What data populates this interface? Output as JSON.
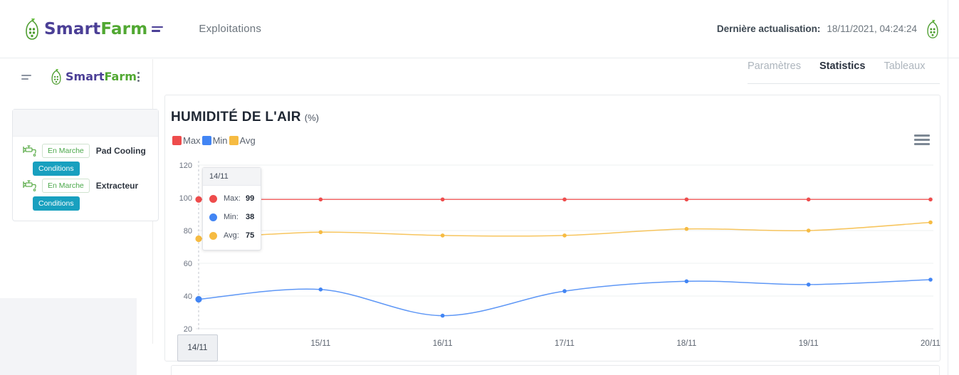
{
  "header": {
    "logo_text_part1": "Smart",
    "logo_text_part2": "Farm",
    "logo_icon": "plant-flask-icon",
    "menu_icon": "hamburger-lines-icon",
    "nav_link": "Exploitations",
    "refresh_label": "Dernière actualisation:",
    "refresh_value": "18/11/2021, 04:24:24",
    "refresh_icon": "plant-flask-icon"
  },
  "tabs": [
    {
      "label": "Paramètres",
      "active": false
    },
    {
      "label": "Statistics",
      "active": true
    },
    {
      "label": "Tableaux",
      "active": false
    }
  ],
  "left_panel": {
    "toggle_icon": "collapse-menu-icon",
    "logo_text_part1": "Smart",
    "logo_text_part2": "Farm",
    "more_icon": "vertical-dots-icon",
    "devices": [
      {
        "icon": "valve-faucet-icon",
        "status": "En Marche",
        "name": "Pad Cooling",
        "action": "Conditions"
      },
      {
        "icon": "valve-faucet-icon",
        "status": "En Marche",
        "name": "Extracteur",
        "action": "Conditions"
      }
    ]
  },
  "chart_card": {
    "title": "HUMIDITÉ DE L'AIR",
    "unit": "(%)",
    "export_menu_icon": "hamburger-menu-icon"
  },
  "tooltip": {
    "date": "14/11",
    "rows": [
      {
        "key": "Max:",
        "value": "99",
        "color": "#ee4c4c"
      },
      {
        "key": "Min:",
        "value": "38",
        "color": "#4285f4"
      },
      {
        "key": "Avg:",
        "value": "75",
        "color": "#f6bb42"
      }
    ]
  },
  "crosshair_label": "14/11",
  "colors": {
    "max": "#ee4c4c",
    "min": "#4285f4",
    "avg": "#f6bb42",
    "brand_purple": "#4b3f96",
    "brand_green": "#51a832",
    "teal_button": "#18a0bf",
    "status_green": "#4aa84a"
  },
  "chart_data": {
    "type": "line",
    "title": "HUMIDITÉ DE L'AIR (%)",
    "xlabel": "",
    "ylabel": "",
    "unit": "%",
    "categories": [
      "14/11",
      "15/11",
      "16/11",
      "17/11",
      "18/11",
      "19/11",
      "20/11"
    ],
    "ylim": [
      20,
      120
    ],
    "yticks": [
      120,
      100,
      80,
      60,
      40,
      20
    ],
    "grid": true,
    "legend_position": "top-left",
    "smooth": true,
    "series": [
      {
        "name": "Max",
        "color": "#ee4c4c",
        "values": [
          99,
          99,
          99,
          99,
          99,
          99,
          99
        ]
      },
      {
        "name": "Min",
        "color": "#4285f4",
        "values": [
          38,
          44,
          28,
          43,
          49,
          47,
          50
        ]
      },
      {
        "name": "Avg",
        "color": "#f6bb42",
        "values": [
          75,
          79,
          77,
          77,
          81,
          80,
          85
        ]
      }
    ],
    "highlighted_category": "14/11"
  }
}
